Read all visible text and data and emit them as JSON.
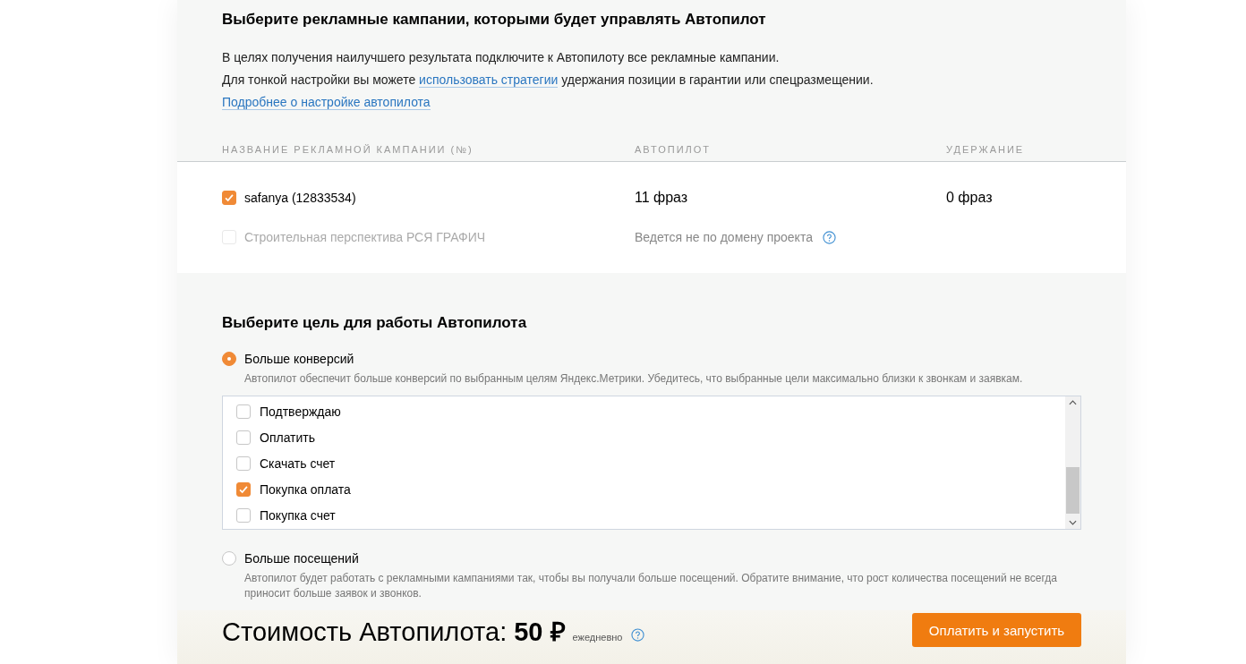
{
  "campaigns_section": {
    "title": "Выберите рекламные кампании, которыми будет управлять Автопилот",
    "intro": "В целях получения наилучшего результата подключите к Автопилоту все рекламные кампании.",
    "strategy_note": {
      "before": "Для тонкой настройки вы можете ",
      "link": "использовать стратегии",
      "after": " удержания позиции в гарантии или спецразмещении."
    },
    "more_link": "Подробнее о настройке автопилота",
    "table": {
      "columns": [
        "НАЗВАНИЕ РЕКЛАМНОЙ КАМПАНИИ (№)",
        "АВТОПИЛОТ",
        "УДЕРЖАНИЕ"
      ],
      "rows": [
        {
          "name": "safanya (12833534)",
          "checked": true,
          "disabled": false,
          "autopilot": "11 фраз",
          "hold": "0 фраз",
          "help": false
        },
        {
          "name": "Строительная перспектива РСЯ ГРАФИЧ",
          "checked": false,
          "disabled": true,
          "autopilot": "Ведется не по домену проекта",
          "hold": "",
          "help": true
        }
      ]
    }
  },
  "goal_section": {
    "title": "Выберите цель для работы Автопилота",
    "options": [
      {
        "label": "Больше конверсий",
        "selected": true,
        "description": "Автопилот обеспечит больше конверсий по выбранным целям Яндекс.Метрики. Убедитесь, что выбранные цели максимально близки к звонкам и заявкам.",
        "goals": [
          {
            "label": "Подтверждаю",
            "checked": false
          },
          {
            "label": "Оплатить",
            "checked": false
          },
          {
            "label": "Скачать счет",
            "checked": false
          },
          {
            "label": "Покупка оплата",
            "checked": true
          },
          {
            "label": "Покупка счет",
            "checked": false
          }
        ]
      },
      {
        "label": "Больше посещений",
        "selected": false,
        "description": "Автопилот будет работать с рекламными кампаниями так, чтобы вы получали больше посещений. Обратите внимание, что рост количества посещений не всегда приносит больше заявок и звонков."
      }
    ]
  },
  "footer": {
    "cost_label": "Стоимость Автопилота:",
    "price": "50 ₽",
    "period": "ежедневно",
    "button": "Оплатить и запустить"
  }
}
